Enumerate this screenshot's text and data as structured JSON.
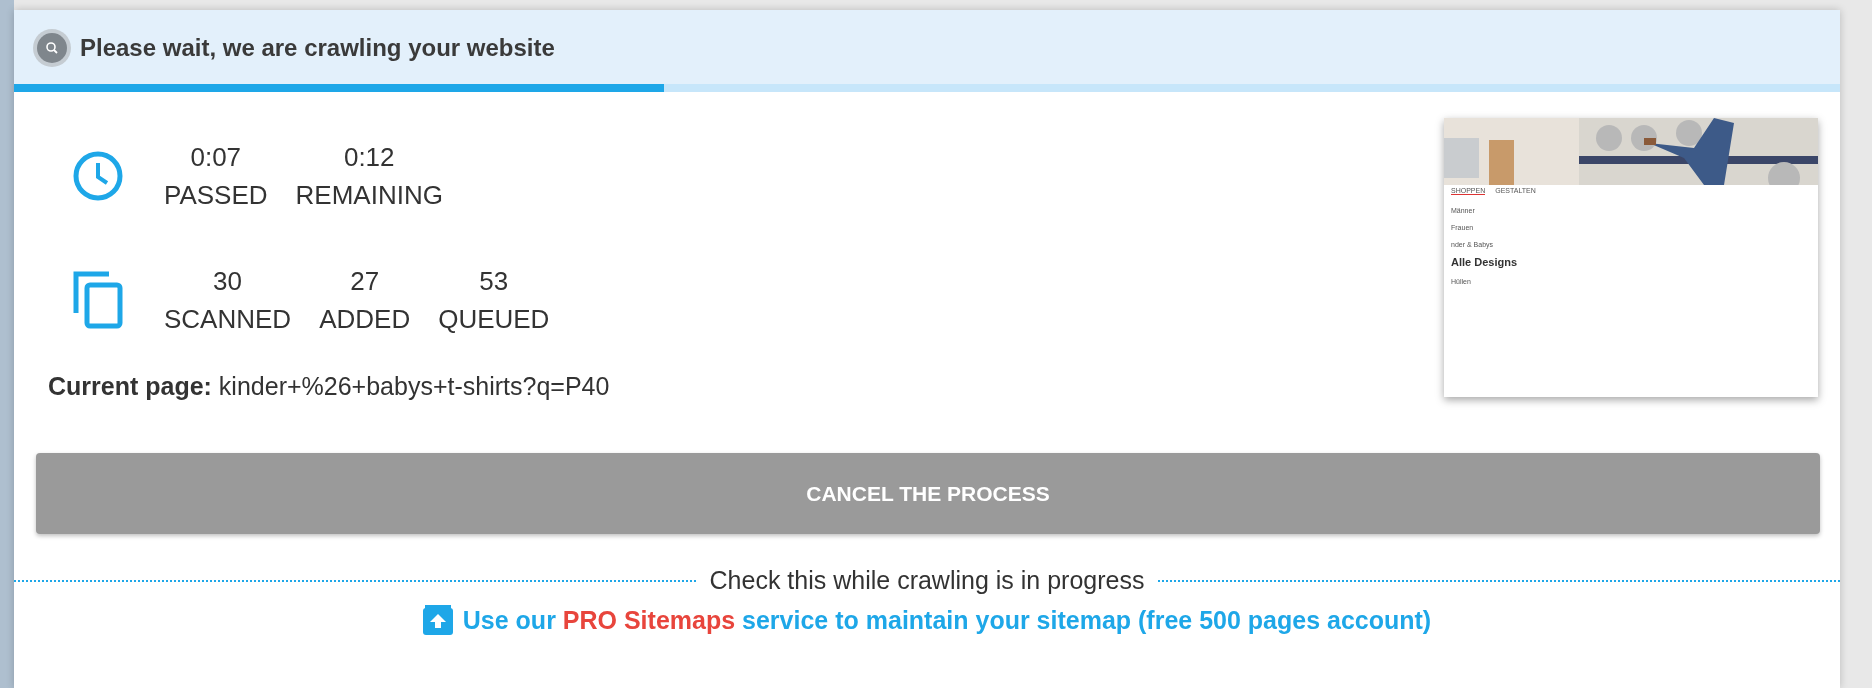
{
  "dialog": {
    "title": "Please wait, we are crawling your website",
    "progress": {
      "level": 0.356
    }
  },
  "stats": [
    {
      "kind": "time",
      "items": [
        {
          "value": "0:07",
          "label": "PASSED"
        },
        {
          "value": "0:12",
          "label": "REMAINING"
        }
      ]
    },
    {
      "kind": "pages",
      "items": [
        {
          "value": "30",
          "label": "SCANNED"
        },
        {
          "value": "27",
          "label": "ADDED"
        },
        {
          "value": "53",
          "label": "QUEUED"
        }
      ]
    }
  ],
  "current_page": {
    "label": "Current page:",
    "value": "kinder+%26+babys+t-shirts?q=P40"
  },
  "preview": {
    "tabs": [
      {
        "label": "SHOPPEN",
        "selected": true
      },
      {
        "label": "GESTALTEN",
        "selected": false
      }
    ],
    "menu": [
      "Männer",
      "Frauen",
      "nder & Babys"
    ],
    "heading": "Alle Designs",
    "menu_after": [
      "Hüllen"
    ]
  },
  "cancel_button": "CANCEL THE PROCESS",
  "promo": {
    "divider_text": "Check this while crawling is in progress",
    "link_parts": [
      {
        "text": "Use our",
        "kind": "plain"
      },
      {
        "text": "PRO Sitemaps",
        "kind": "accent"
      },
      {
        "text": "service to maintain your sitemap (free 500 pages account)",
        "kind": "plain"
      }
    ]
  }
}
